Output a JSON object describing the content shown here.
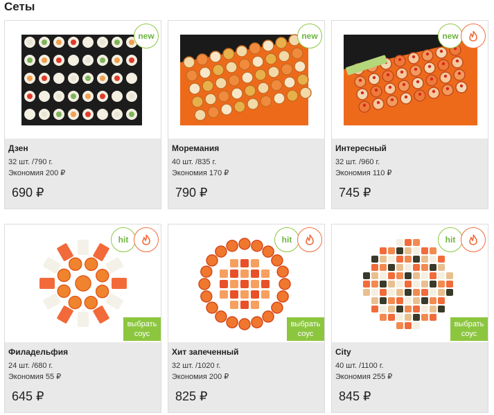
{
  "section": {
    "title": "Сеты"
  },
  "colors": {
    "accent_green": "#8cc63f",
    "fire_orange": "#f26b3a",
    "info_bg": "#e9e9e9"
  },
  "products": [
    {
      "name": "Дзен",
      "pieces": "32 шт. /790 г.",
      "saving": "Экономия 200 ₽",
      "price": "690 ₽",
      "badges": [
        "new"
      ],
      "sauce": ""
    },
    {
      "name": "Моремания",
      "pieces": "40 шт. /835 г.",
      "saving": "Экономия 170 ₽",
      "price": "790 ₽",
      "badges": [
        "new"
      ],
      "sauce": ""
    },
    {
      "name": "Интересный",
      "pieces": "32 шт. /960 г.",
      "saving": "Экономия 110 ₽",
      "price": "745 ₽",
      "badges": [
        "new",
        "fire-icon"
      ],
      "sauce": ""
    },
    {
      "name": "Филадельфия",
      "pieces": "24 шт. /680 г.",
      "saving": "Экономия 55 ₽",
      "price": "645 ₽",
      "badges": [
        "hit",
        "fire-icon"
      ],
      "sauce": "выбрать соус"
    },
    {
      "name": "Хит запеченный",
      "pieces": "32 шт. /1020 г.",
      "saving": "Экономия 200 ₽",
      "price": "825 ₽",
      "badges": [
        "hit",
        "fire-icon"
      ],
      "sauce": "выбрать соус"
    },
    {
      "name": "City",
      "pieces": "40 шт. /1100 г.",
      "saving": "Экономия 255 ₽",
      "price": "845 ₽",
      "badges": [
        "hit",
        "fire-icon"
      ],
      "sauce": "выбрать соус"
    }
  ],
  "badge_labels": {
    "new": "new",
    "hit": "hit"
  }
}
